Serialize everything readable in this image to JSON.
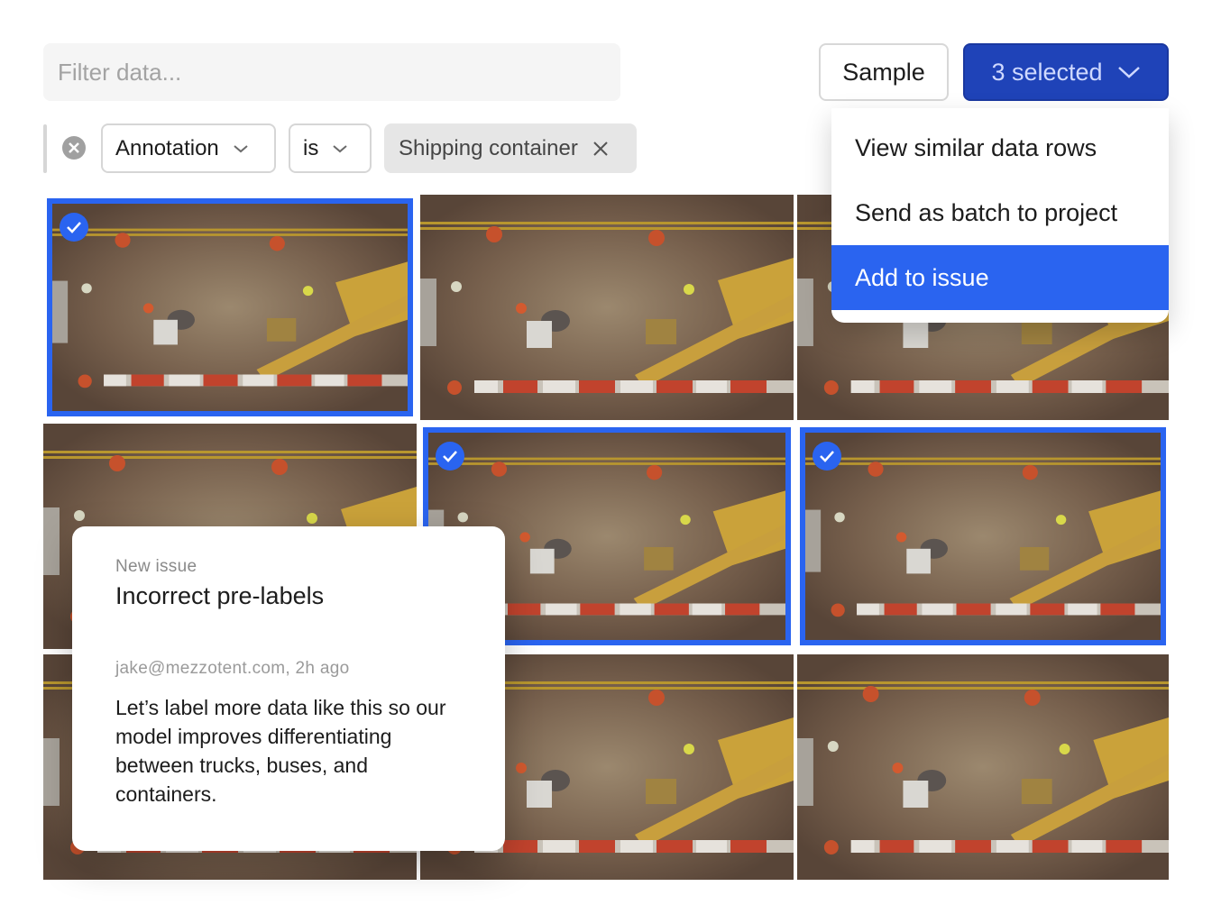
{
  "filter": {
    "placeholder": "Filter data..."
  },
  "toolbar": {
    "sample_label": "Sample",
    "selected_label": "3 selected"
  },
  "filter_row": {
    "field": "Annotation",
    "operator": "is",
    "value": "Shipping container"
  },
  "menu": {
    "items": [
      {
        "label": "View similar data rows"
      },
      {
        "label": "Send as batch to project"
      },
      {
        "label": "Add to issue"
      }
    ],
    "active_item": "Add to issue"
  },
  "issue": {
    "kicker": "New issue",
    "title": "Incorrect pre-labels",
    "meta": "jake@mezzotent.com, 2h ago",
    "body": "Let’s label more data like this so our model improves differentiating between trucks, buses, and containers."
  },
  "grid": {
    "images": [
      {
        "selected": true
      },
      {
        "selected": false
      },
      {
        "selected": false
      },
      {
        "selected": false
      },
      {
        "selected": true
      },
      {
        "selected": true
      },
      {
        "selected": false
      },
      {
        "selected": false
      },
      {
        "selected": false
      }
    ]
  },
  "colors": {
    "accent": "#2a64f0",
    "selected_button": "#1f43b8"
  }
}
